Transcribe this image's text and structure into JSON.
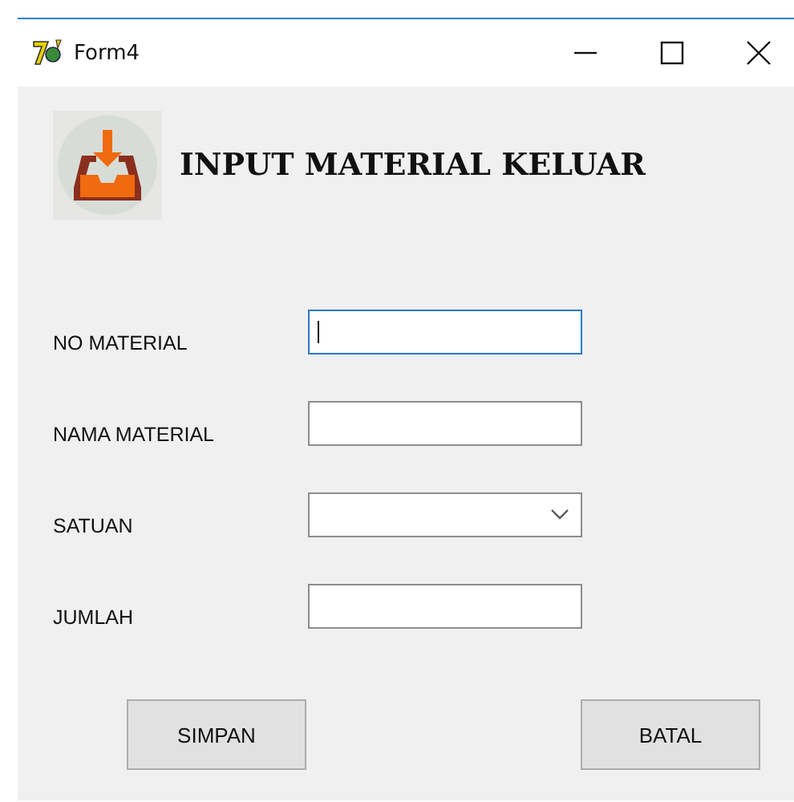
{
  "window": {
    "title": "Form4"
  },
  "header": {
    "title": "INPUT MATERIAL KELUAR"
  },
  "fields": [
    {
      "label": "NO MATERIAL",
      "kind": "text",
      "focused": true
    },
    {
      "label": "NAMA MATERIAL",
      "kind": "text",
      "focused": false
    },
    {
      "label": "SATUAN",
      "kind": "dropdown",
      "focused": false
    },
    {
      "label": "JUMLAH",
      "kind": "text",
      "focused": false
    }
  ],
  "buttons": [
    "SIMPAN",
    "BATAL"
  ]
}
